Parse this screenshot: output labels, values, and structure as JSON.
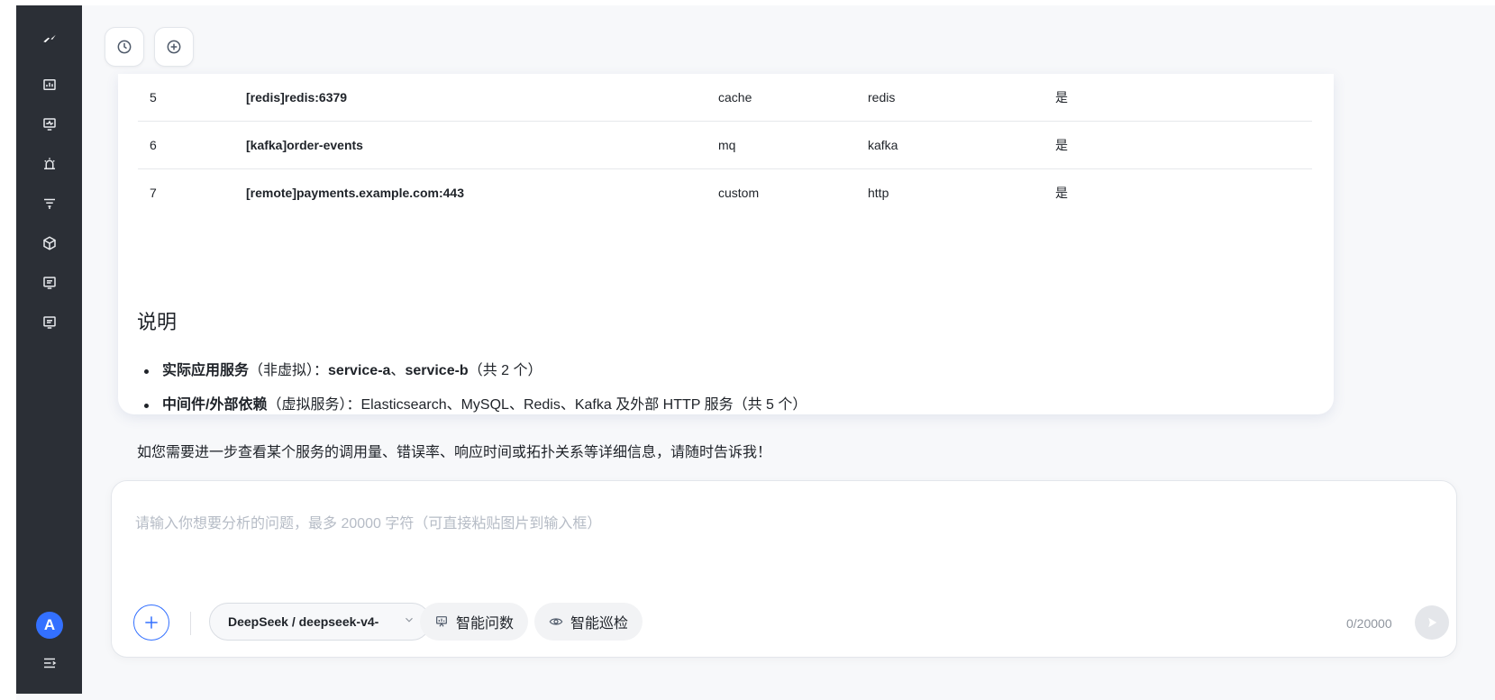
{
  "sidebar": {
    "icons": [
      "logo-icon",
      "dashboard-icon",
      "monitor-icon",
      "alert-icon",
      "filter-icon",
      "cube-icon",
      "document-icon",
      "document-icon"
    ],
    "avatar_initial": "A",
    "collapse_icon": "collapse-sidebar-icon"
  },
  "toolbar": {
    "history_icon": "clock-icon",
    "new_chat_icon": "plus-circle-icon"
  },
  "table": {
    "rows": [
      {
        "index": "5",
        "name": "[redis]redis:6379",
        "category": "cache",
        "type": "redis",
        "virtual": "是"
      },
      {
        "index": "6",
        "name": "[kafka]order-events",
        "category": "mq",
        "type": "kafka",
        "virtual": "是"
      },
      {
        "index": "7",
        "name": "[remote]payments.example.com:443",
        "category": "custom",
        "type": "http",
        "virtual": "是"
      }
    ]
  },
  "explanation": {
    "heading": "说明",
    "bullet1_bold": "实际应用服务",
    "bullet1_mid": "（非虚拟）：",
    "bullet1_svc_a": "service-a",
    "bullet1_sep": "、",
    "bullet1_svc_b": "service-b",
    "bullet1_tail": "（共 2 个）",
    "bullet2_bold": "中间件/外部依赖",
    "bullet2_rest": "（虚拟服务）：Elasticsearch、MySQL、Redis、Kafka 及外部 HTTP 服务（共 5 个）",
    "note": "如您需要进一步查看某个服务的调用量、错误率、响应时间或拓扑关系等详细信息，请随时告诉我！"
  },
  "composer": {
    "placeholder": "请输入你想要分析的问题，最多 20000 字符（可直接粘贴图片到输入框）",
    "model": "DeepSeek / deepseek-v4-",
    "pill1": "智能问数",
    "pill2": "智能巡检",
    "counter": "0/20000"
  },
  "colors": {
    "sidebar_bg": "#2b2f36",
    "accent": "#3370ff"
  }
}
